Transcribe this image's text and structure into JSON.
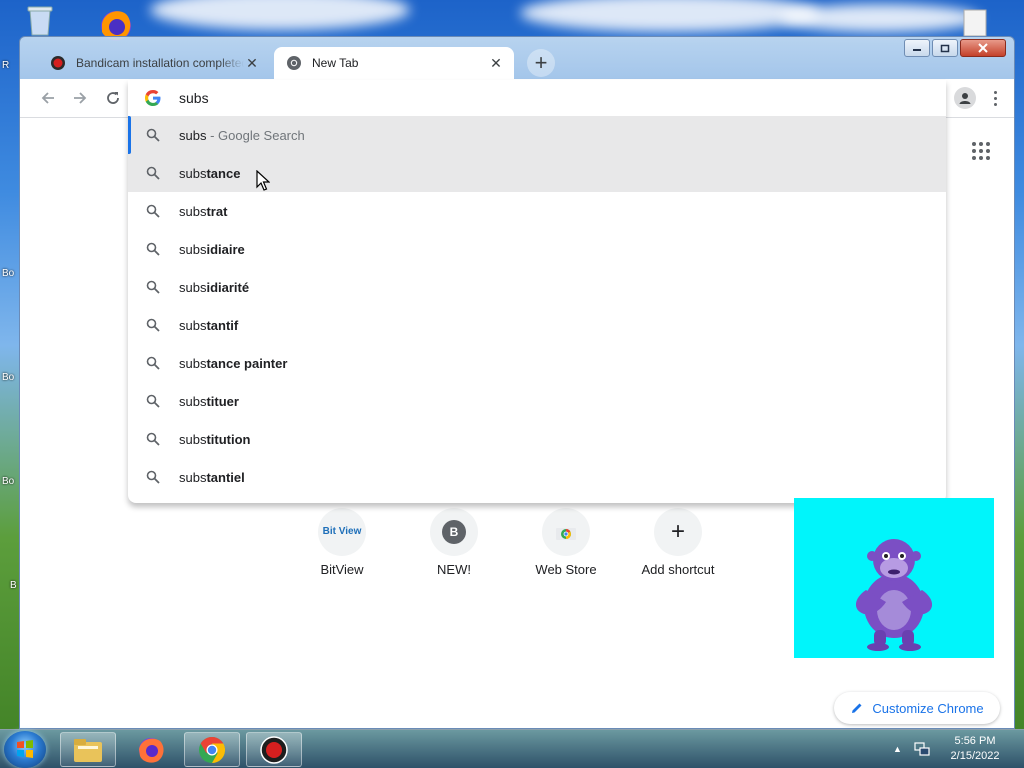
{
  "desktop": {
    "left_labels": [
      "R",
      "Bo",
      "Bo",
      "Bo",
      "B"
    ]
  },
  "browser": {
    "tabs": [
      {
        "title": "Bandicam installation completed",
        "close": "✕",
        "active": false
      },
      {
        "title": "New Tab",
        "close": "✕",
        "active": true
      }
    ],
    "new_tab_symbol": "+",
    "omnibox": {
      "typed_text": "subs",
      "suggestions": [
        {
          "prefix": "subs",
          "completion": "",
          "description": " - Google Search",
          "state": "selected"
        },
        {
          "prefix": "subs",
          "completion": "tance",
          "description": "",
          "state": "hovered"
        },
        {
          "prefix": "subs",
          "completion": "trat",
          "description": "",
          "state": ""
        },
        {
          "prefix": "subs",
          "completion": "idiaire",
          "description": "",
          "state": ""
        },
        {
          "prefix": "subs",
          "completion": "idiarité",
          "description": "",
          "state": ""
        },
        {
          "prefix": "subs",
          "completion": "tantif",
          "description": "",
          "state": ""
        },
        {
          "prefix": "subs",
          "completion": "tance painter",
          "description": "",
          "state": ""
        },
        {
          "prefix": "subs",
          "completion": "tituer",
          "description": "",
          "state": ""
        },
        {
          "prefix": "subs",
          "completion": "titution",
          "description": "",
          "state": ""
        },
        {
          "prefix": "subs",
          "completion": "tantiel",
          "description": "",
          "state": ""
        }
      ]
    },
    "shortcuts": [
      {
        "label": "BitView",
        "icon": "bitview-icon",
        "logo_text": "Bit View"
      },
      {
        "label": "NEW!",
        "icon": "letter-b-avatar",
        "logo_text": "B"
      },
      {
        "label": "Web Store",
        "icon": "chrome-web-store-icon",
        "logo_text": ""
      },
      {
        "label": "Add shortcut",
        "icon": "plus-icon",
        "logo_text": "+"
      }
    ],
    "customize_label": "Customize Chrome"
  },
  "taskbar": {
    "time": "5:56 PM",
    "date": "2/15/2022",
    "apps": [
      "windows-explorer-icon",
      "firefox-icon",
      "chrome-icon",
      "bandicam-icon"
    ]
  },
  "colors": {
    "accent": "#1a73e8",
    "bonzi_background": "#00f5fb",
    "bandicam_red": "#d61f1f"
  }
}
